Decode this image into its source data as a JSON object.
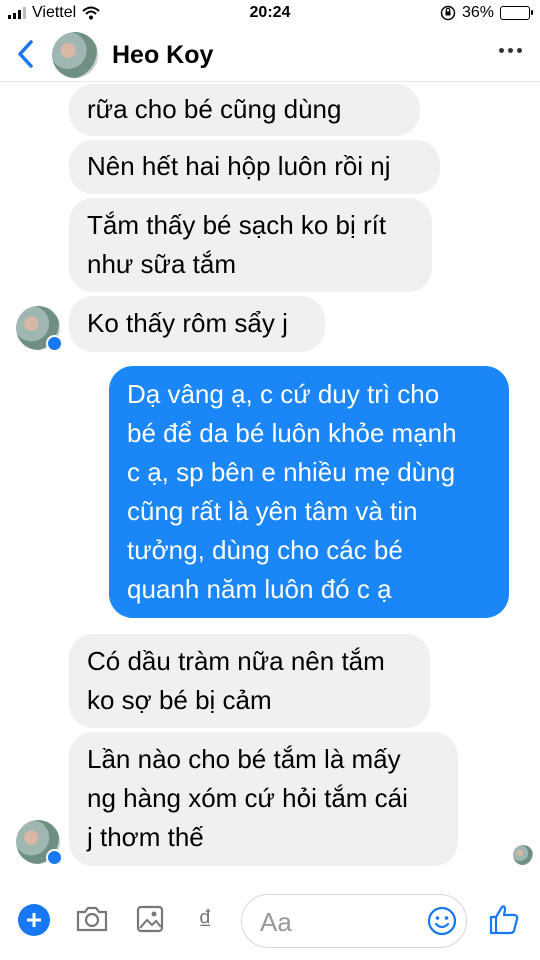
{
  "status_bar": {
    "carrier": "Viettel",
    "time": "20:24",
    "battery": "36%",
    "battery_level": 0.36
  },
  "header": {
    "contact_name": "Heo Koy"
  },
  "messages": [
    {
      "side": "in",
      "text": "rữa cho bé cũng dùng"
    },
    {
      "side": "in",
      "text": "Nên hết hai hộp luôn rồi nj"
    },
    {
      "side": "in",
      "text": "Tắm thấy bé sạch ko bị rít\nnhư sữa tắm"
    },
    {
      "side": "in",
      "text": "Ko thấy rôm sẩy j"
    },
    {
      "side": "out",
      "text": "Dạ vâng ạ, c cứ duy trì cho\nbé để da bé luôn khỏe mạnh\nc ạ, sp bên e nhiều mẹ dùng\ncũng rất là yên tâm và tin\ntưởng, dùng cho các bé\nquanh năm luôn đó c ạ"
    },
    {
      "side": "in",
      "text": "Có dầu tràm nữa nên tắm\nko sợ bé bị cảm"
    },
    {
      "side": "in",
      "text": "Lần nào cho bé tắm là mấy\nng hàng xóm cứ hỏi tắm cái\nj thơm thế"
    }
  ],
  "composer": {
    "placeholder": "Aa",
    "currency_icon_glyph": "₫"
  },
  "icons": {
    "back": "chevron-left-icon",
    "more": "more-horizontal-icon",
    "add": "plus-icon",
    "camera": "camera-icon",
    "gallery": "image-icon",
    "emoji": "smile-icon",
    "like": "thumbs-up-icon"
  },
  "colors": {
    "accent": "#1877f2",
    "outgoing_bubble": "#1a86f7",
    "incoming_bubble": "#f0f0f0"
  }
}
